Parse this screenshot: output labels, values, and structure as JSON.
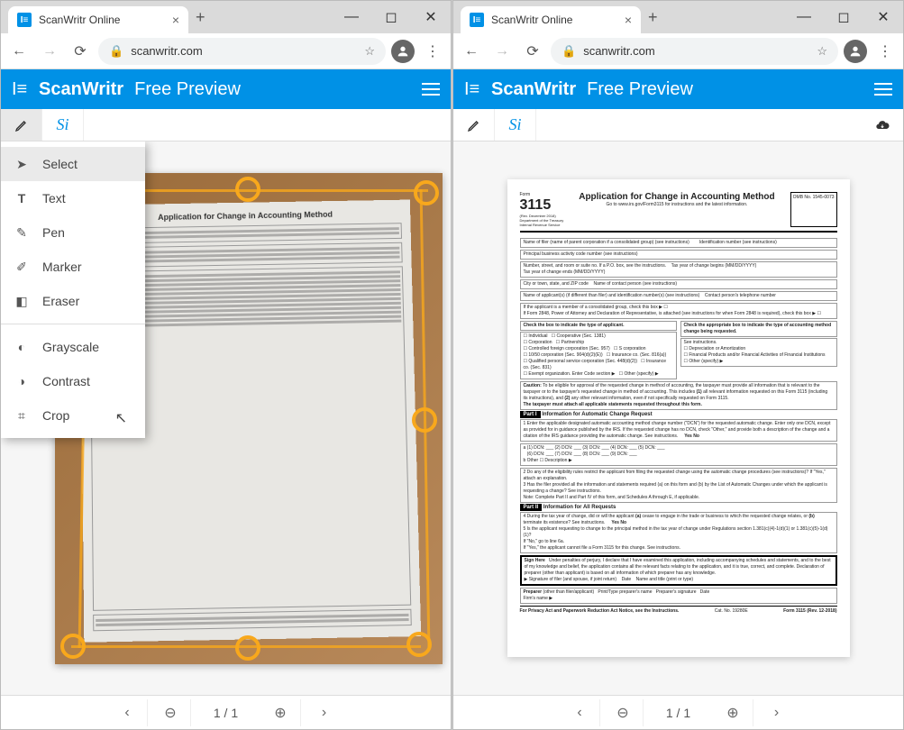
{
  "browser": {
    "tab_title": "ScanWritr Online",
    "url": "scanwritr.com"
  },
  "app": {
    "brand": "ScanWritr",
    "subtitle": "Free Preview"
  },
  "tools": {
    "edit_label": "Edit",
    "sign_label": "Si"
  },
  "menu": {
    "select": "Select",
    "text": "Text",
    "pen": "Pen",
    "marker": "Marker",
    "eraser": "Eraser",
    "grayscale": "Grayscale",
    "contrast": "Contrast",
    "crop": "Crop"
  },
  "document": {
    "form_number": "3115",
    "form_title": "Application for Change in Accounting Method",
    "instructions_link": "Go to www.irs.gov/Form3115 for instructions and the latest information.",
    "omb": "OMB No. 1545-0073",
    "part1": "Part I",
    "part1_title": "Information for Automatic Change Request",
    "part2": "Part II",
    "part2_title": "Information for All Requests",
    "sign": "Sign Here",
    "preparer": "Preparer",
    "footer": "For Privacy Act and Paperwork Reduction Act Notice, see the Instructions.",
    "form_footer": "Form 3115 (Rev. 12-2018)"
  },
  "pager": {
    "current": "1",
    "sep": "/",
    "total": "1"
  },
  "colors": {
    "brand": "#0091e6",
    "crop": "#f8a81c"
  }
}
